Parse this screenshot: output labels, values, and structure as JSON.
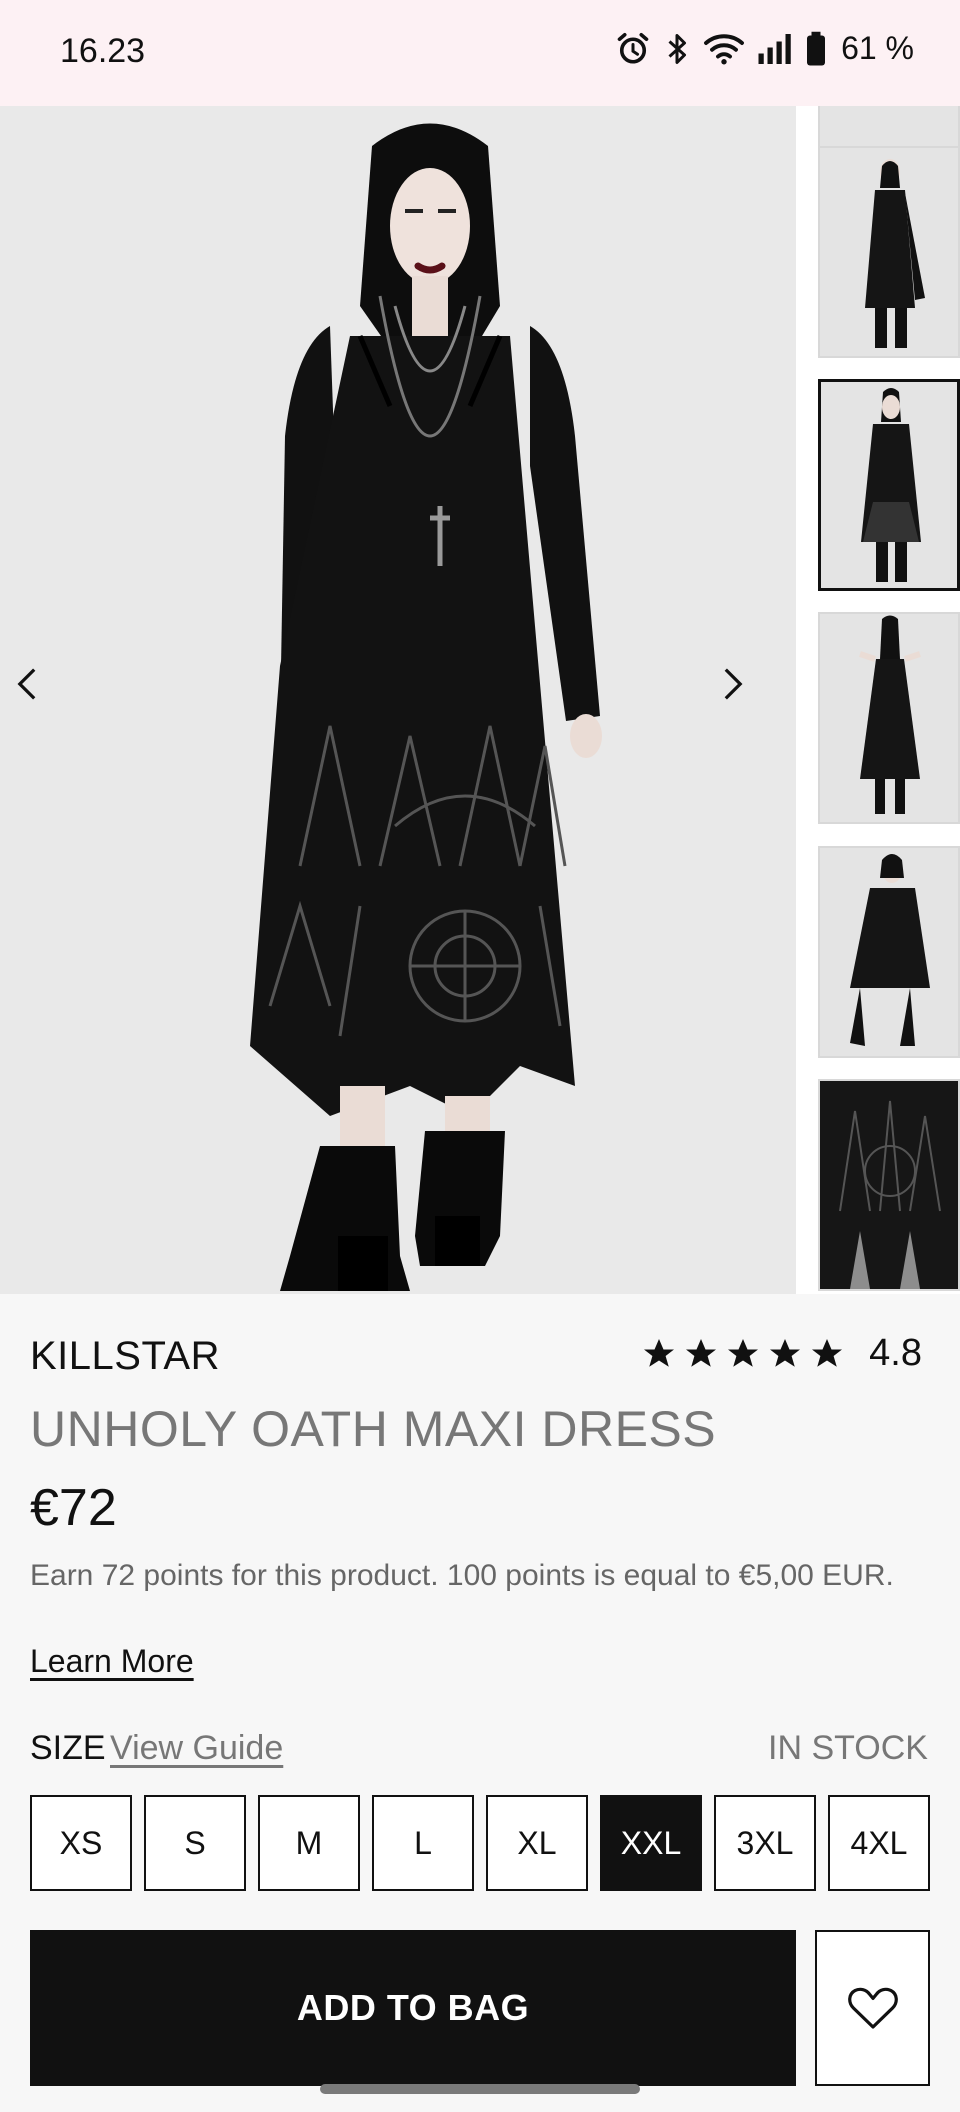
{
  "status_bar": {
    "time": "16.23",
    "battery": "61 %",
    "icons": [
      "alarm-icon",
      "bluetooth-icon",
      "wifi-icon",
      "signal-icon",
      "battery-icon"
    ]
  },
  "gallery": {
    "prev_icon": "chevron-left-icon",
    "next_icon": "chevron-right-icon",
    "thumbnail_count": 6,
    "active_thumbnail_index": 2
  },
  "product": {
    "brand": "KILLSTAR",
    "rating": "4.8",
    "stars": 5,
    "name": "UNHOLY OATH MAXI DRESS",
    "price": "€72",
    "points_text": "Earn 72 points for this product. 100 points is equal to €5,00 EUR.",
    "learn_more": "Learn More"
  },
  "size_selector": {
    "label": "SIZE",
    "guide_link": "View Guide",
    "stock_status": "IN STOCK",
    "options": [
      "XS",
      "S",
      "M",
      "L",
      "XL",
      "XXL",
      "3XL",
      "4XL"
    ],
    "selected": "XXL"
  },
  "actions": {
    "add_to_bag": "ADD TO BAG",
    "wishlist_icon": "heart-icon"
  },
  "colors": {
    "accent": "#111111",
    "status_bar_bg": "#fdf1f4",
    "page_bg": "#f7f7f7",
    "muted_text": "#777777"
  }
}
